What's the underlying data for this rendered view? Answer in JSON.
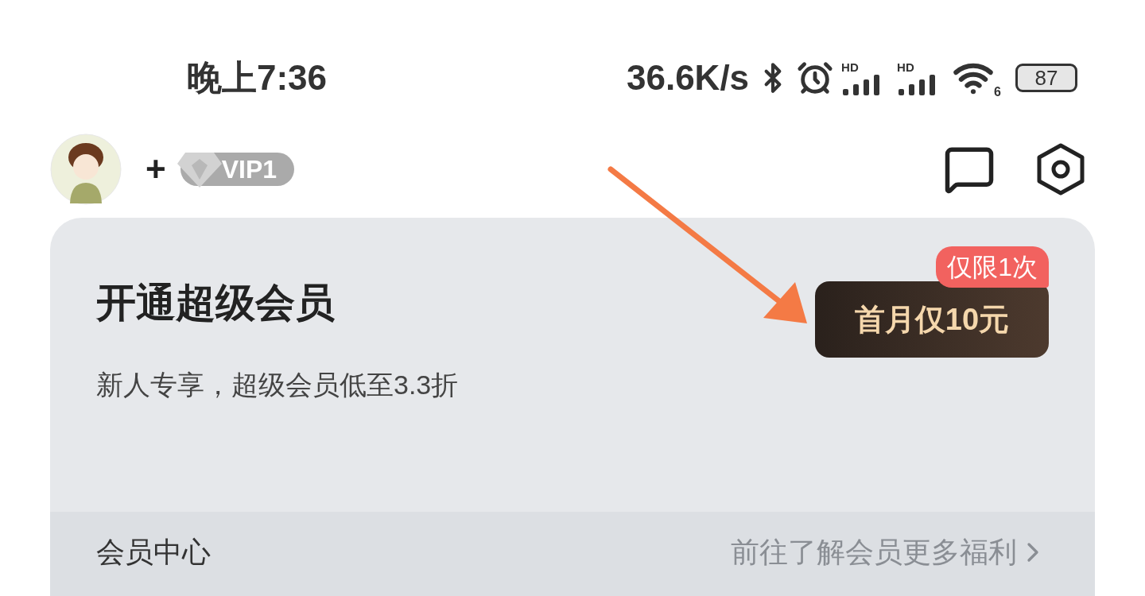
{
  "status_bar": {
    "time": "晚上7:36",
    "net_speed": "36.6K/s",
    "signals": [
      {
        "label": "HD"
      },
      {
        "label": "HD"
      }
    ],
    "wifi_label": "6",
    "battery": "87"
  },
  "header": {
    "plus": "+",
    "vip_badge": "VIP1"
  },
  "card": {
    "title": "开通超级会员",
    "subtitle": "新人专享，超级会员低至3.3折",
    "button": "首月仅10元",
    "badge": "仅限1次"
  },
  "footer": {
    "label": "会员中心",
    "link": "前往了解会员更多福利"
  }
}
